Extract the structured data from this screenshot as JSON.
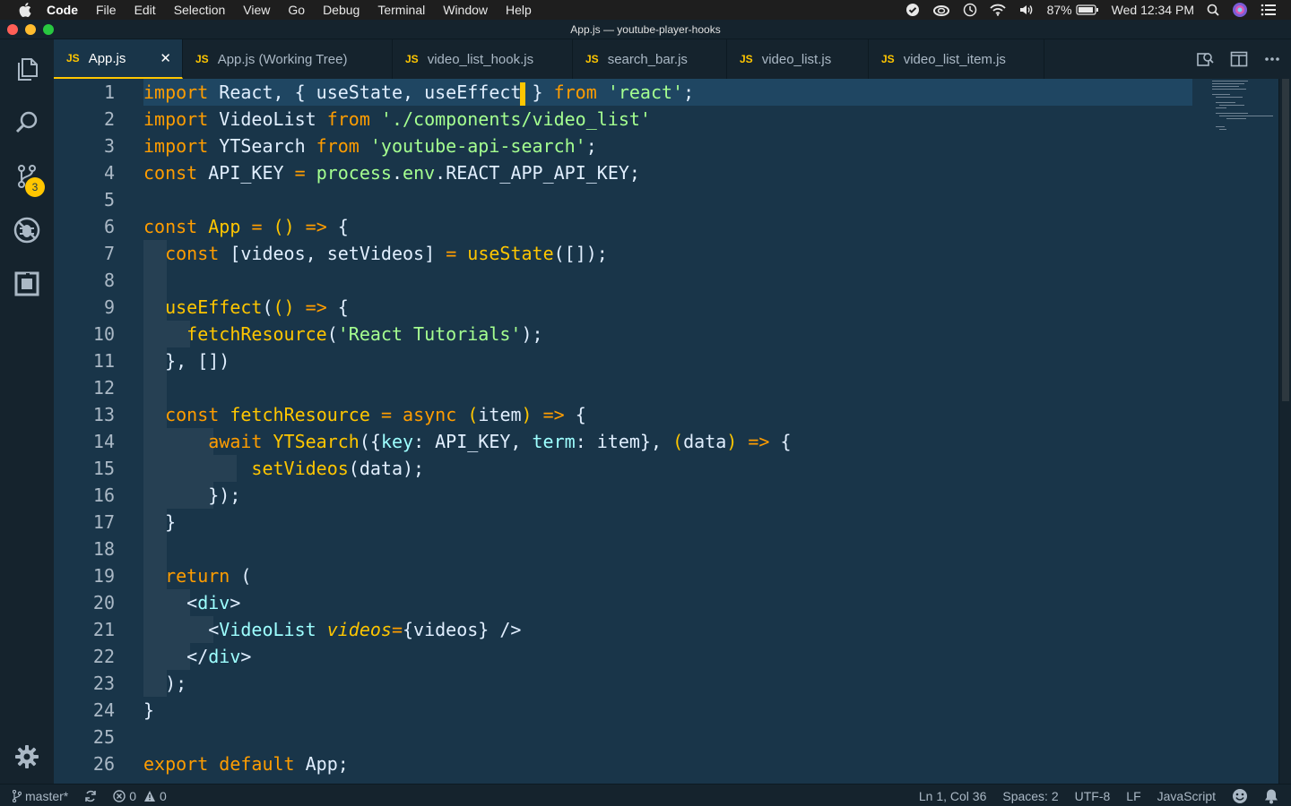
{
  "menubar": {
    "app": "Code",
    "items": [
      "File",
      "Edit",
      "Selection",
      "View",
      "Go",
      "Debug",
      "Terminal",
      "Window",
      "Help"
    ],
    "battery": "87%",
    "clock": "Wed 12:34 PM"
  },
  "window": {
    "title": "App.js — youtube-player-hooks"
  },
  "activity": {
    "scm_badge": "3"
  },
  "tabs": [
    {
      "icon": "JS",
      "label": "App.js"
    },
    {
      "icon": "JS",
      "label": "App.js (Working Tree)"
    },
    {
      "icon": "JS",
      "label": "video_list_hook.js"
    },
    {
      "icon": "JS",
      "label": "search_bar.js"
    },
    {
      "icon": "JS",
      "label": "video_list.js"
    },
    {
      "icon": "JS",
      "label": "video_list_item.js"
    }
  ],
  "editor": {
    "line_numbers": [
      "1",
      "2",
      "3",
      "4",
      "5",
      "6",
      "7",
      "8",
      "9",
      "10",
      "11",
      "12",
      "13",
      "14",
      "15",
      "16",
      "17",
      "18",
      "19",
      "20",
      "21",
      "22",
      "23",
      "24",
      "25",
      "26"
    ],
    "lines": [
      [
        [
          "kw",
          "import"
        ],
        [
          "tx",
          " React, "
        ],
        [
          "pun",
          "{ "
        ],
        [
          "tx",
          "useState, useEffect"
        ],
        [
          "cur",
          ""
        ],
        [
          "pun",
          " }"
        ],
        [
          "tx",
          " "
        ],
        [
          "kw",
          "from"
        ],
        [
          "tx",
          " "
        ],
        [
          "str",
          "'react'"
        ],
        [
          "pun",
          ";"
        ]
      ],
      [
        [
          "kw",
          "import"
        ],
        [
          "tx",
          " VideoList "
        ],
        [
          "kw",
          "from"
        ],
        [
          "tx",
          " "
        ],
        [
          "str",
          "'./components/video_list'"
        ]
      ],
      [
        [
          "kw",
          "import"
        ],
        [
          "tx",
          " YTSearch "
        ],
        [
          "kw",
          "from"
        ],
        [
          "tx",
          " "
        ],
        [
          "str",
          "'youtube-api-search'"
        ],
        [
          "pun",
          ";"
        ]
      ],
      [
        [
          "kw",
          "const"
        ],
        [
          "tx",
          " API_KEY "
        ],
        [
          "op",
          "="
        ],
        [
          "tx",
          " "
        ],
        [
          "str",
          "process"
        ],
        [
          "pun",
          "."
        ],
        [
          "str",
          "env"
        ],
        [
          "pun",
          "."
        ],
        [
          "tx",
          "REACT_APP_API_KEY;"
        ]
      ],
      [],
      [
        [
          "kw",
          "const"
        ],
        [
          "tx",
          " "
        ],
        [
          "fn",
          "App"
        ],
        [
          "tx",
          " "
        ],
        [
          "op",
          "="
        ],
        [
          "tx",
          " "
        ],
        [
          "fn",
          "()"
        ],
        [
          "tx",
          " "
        ],
        [
          "op",
          "=>"
        ],
        [
          "tx",
          " {"
        ]
      ],
      [
        [
          "tx",
          "  "
        ],
        [
          "kw",
          "const"
        ],
        [
          "tx",
          " [videos, setVideos] "
        ],
        [
          "op",
          "="
        ],
        [
          "tx",
          " "
        ],
        [
          "fn",
          "useState"
        ],
        [
          "tx",
          "([]);"
        ]
      ],
      [],
      [
        [
          "tx",
          "  "
        ],
        [
          "fn",
          "useEffect"
        ],
        [
          "tx",
          "("
        ],
        [
          "fn",
          "()"
        ],
        [
          "tx",
          " "
        ],
        [
          "op",
          "=>"
        ],
        [
          "tx",
          " {"
        ]
      ],
      [
        [
          "tx",
          "    "
        ],
        [
          "fn",
          "fetchResource"
        ],
        [
          "tx",
          "("
        ],
        [
          "str",
          "'React Tutorials'"
        ],
        [
          "tx",
          ");"
        ]
      ],
      [
        [
          "tx",
          "  }, [])"
        ]
      ],
      [],
      [
        [
          "tx",
          "  "
        ],
        [
          "kw",
          "const"
        ],
        [
          "tx",
          " "
        ],
        [
          "fn",
          "fetchResource"
        ],
        [
          "tx",
          " "
        ],
        [
          "op",
          "="
        ],
        [
          "tx",
          " "
        ],
        [
          "kw",
          "async"
        ],
        [
          "tx",
          " "
        ],
        [
          "fn",
          "("
        ],
        [
          "tx",
          "item"
        ],
        [
          "fn",
          ")"
        ],
        [
          "tx",
          " "
        ],
        [
          "op",
          "=>"
        ],
        [
          "tx",
          " {"
        ]
      ],
      [
        [
          "tx",
          "      "
        ],
        [
          "kw",
          "await"
        ],
        [
          "tx",
          " "
        ],
        [
          "fn",
          "YTSearch"
        ],
        [
          "tx",
          "({"
        ],
        [
          "prop",
          "key"
        ],
        [
          "tx",
          ": API_KEY, "
        ],
        [
          "prop",
          "term"
        ],
        [
          "tx",
          ": item}, "
        ],
        [
          "fn",
          "("
        ],
        [
          "tx",
          "data"
        ],
        [
          "fn",
          ")"
        ],
        [
          "tx",
          " "
        ],
        [
          "op",
          "=>"
        ],
        [
          "tx",
          " {"
        ]
      ],
      [
        [
          "tx",
          "          "
        ],
        [
          "fn",
          "setVideos"
        ],
        [
          "tx",
          "(data);"
        ]
      ],
      [
        [
          "tx",
          "      });"
        ]
      ],
      [
        [
          "tx",
          "  }"
        ]
      ],
      [],
      [
        [
          "tx",
          "  "
        ],
        [
          "kw",
          "return"
        ],
        [
          "tx",
          " ("
        ]
      ],
      [
        [
          "tx",
          "    <"
        ],
        [
          "tag",
          "div"
        ],
        [
          "tx",
          ">"
        ]
      ],
      [
        [
          "tx",
          "      <"
        ],
        [
          "tag",
          "VideoList"
        ],
        [
          "tx",
          " "
        ],
        [
          "attr",
          "videos"
        ],
        [
          "op",
          "="
        ],
        [
          "tx",
          "{videos} />"
        ]
      ],
      [
        [
          "tx",
          "    </"
        ],
        [
          "tag",
          "div"
        ],
        [
          "tx",
          ">"
        ]
      ],
      [
        [
          "tx",
          "  );"
        ]
      ],
      [
        [
          "tx",
          "}"
        ]
      ],
      [],
      [
        [
          "kw",
          "export"
        ],
        [
          "tx",
          " "
        ],
        [
          "kw",
          "default"
        ],
        [
          "tx",
          " App;"
        ]
      ]
    ]
  },
  "status": {
    "branch": "master*",
    "errors": "0",
    "warnings": "0",
    "position": "Ln 1, Col 36",
    "spaces": "Spaces: 2",
    "encoding": "UTF-8",
    "eol": "LF",
    "language": "JavaScript"
  },
  "colors": {
    "accent": "#ffc600",
    "background": "#193549",
    "chrome": "#15232d",
    "keyword": "#ff9d00",
    "string": "#a5ff90"
  }
}
